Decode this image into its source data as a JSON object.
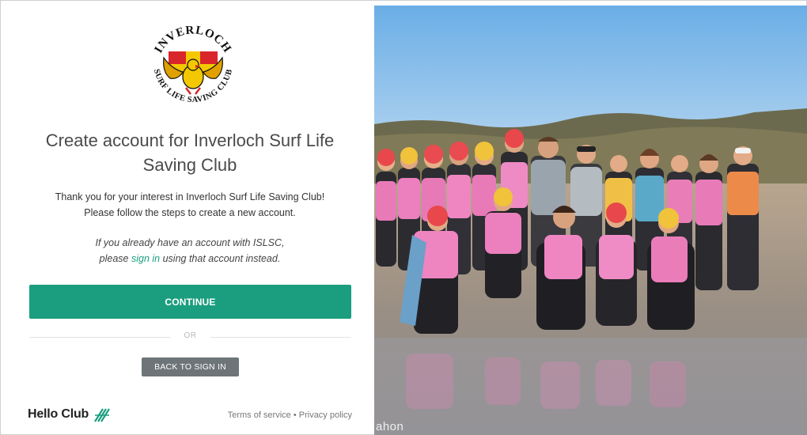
{
  "logo": {
    "top_text": "INVERLOCH",
    "bottom_text": "SURF LIFE SAVING CLUB"
  },
  "signup": {
    "title": "Create account for Inverloch Surf Life Saving Club",
    "intro_line1": "Thank you for your interest in Inverloch Surf Life Saving Club!",
    "intro_line2": "Please follow the steps to create a new account.",
    "existing_line1": "If you already have an account with ISLSC,",
    "existing_prefix": "please ",
    "sign_in_link": "sign in",
    "existing_suffix": " using that account instead.",
    "continue_label": "CONTINUE",
    "or_label": "OR",
    "back_label": "BACK TO SIGN IN"
  },
  "footer": {
    "brand": "Hello Club",
    "brand_icon": "hello-club-logo-icon",
    "terms": "Terms of service",
    "separator": " • ",
    "privacy": "Privacy policy"
  },
  "photo": {
    "caption": "ahon"
  },
  "colors": {
    "accent": "#1b9e7f",
    "link": "#1a9e80",
    "secondary_button": "#6d7578",
    "title_text": "#4a4a4a"
  }
}
